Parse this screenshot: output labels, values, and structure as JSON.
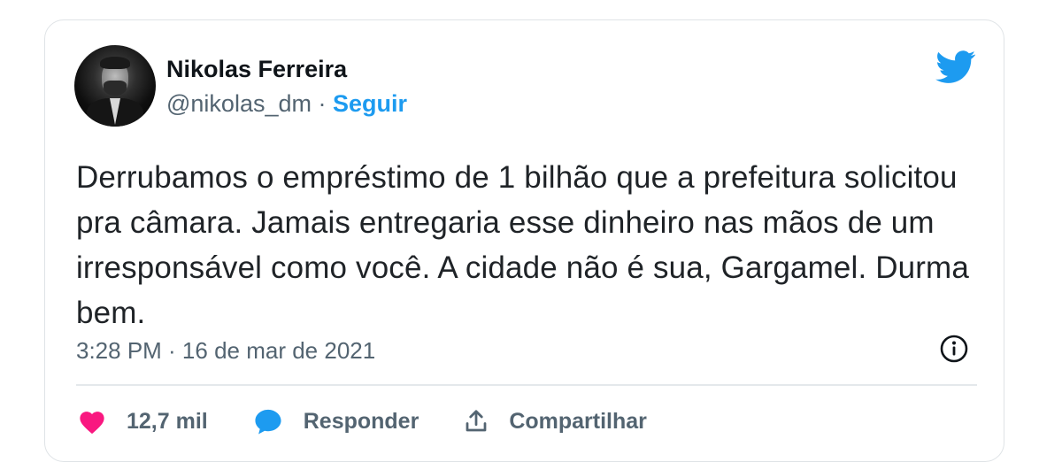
{
  "tweet": {
    "author_name": "Nikolas Ferreira",
    "handle": "@nikolas_dm",
    "separator": " · ",
    "follow_label": "Seguir",
    "text": "Derrubamos o empréstimo de 1 bilhão que a prefeitura solicitou pra câmara. Jamais entregaria esse dinheiro nas mãos de um irresponsável como você. A cidade não é sua, Gargamel. Durma bem.",
    "timestamp": "3:28 PM · 16 de mar de 2021",
    "likes_count": "12,7 mil",
    "reply_label": "Responder",
    "share_label": "Compartilhar"
  },
  "icons": {
    "brand": "twitter-bird-icon",
    "info": "info-icon",
    "like": "heart-icon",
    "reply": "reply-bubble-icon",
    "share": "share-icon"
  },
  "colors": {
    "brand": "#1d9bf0",
    "like": "#f91880",
    "text": "#0f1419",
    "muted": "#536471"
  }
}
